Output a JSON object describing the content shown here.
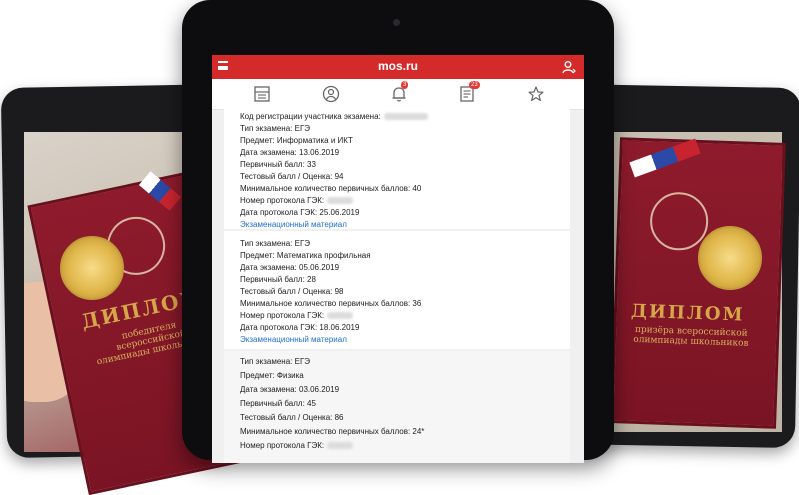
{
  "header": {
    "brand": "mos.ru"
  },
  "nav": {
    "notifications_badge": "3",
    "documents_badge": "23"
  },
  "photos": {
    "left_diploma_title": "ДИПЛОМ",
    "left_diploma_subtitle": "победителя всероссийской олимпиады школьников",
    "right_diploma_title": "ДИПЛОМ",
    "right_diploma_subtitle": "призёра всероссийской олимпиады школьников"
  },
  "exams": {
    "registration_label": "Код регистрации участника экзамена:",
    "card1": {
      "type": "Тип экзамена: ЕГЭ",
      "subject": "Предмет: Информатика и ИКТ",
      "date": "Дата экзамена: 13.06.2019",
      "primary": "Первичный балл: 33",
      "test": "Тестовый балл / Оценка: 94",
      "min": "Минимальное количество первичных баллов: 40",
      "protocol_no": "Номер протокола ГЭК:",
      "protocol_date": "Дата протокола ГЭК: 25.06.2019",
      "material": "Экзаменационный материал"
    },
    "card2": {
      "type": "Тип экзамена: ЕГЭ",
      "subject": "Предмет: Математика профильная",
      "date": "Дата экзамена: 05.06.2019",
      "primary": "Первичный балл: 28",
      "test": "Тестовый балл / Оценка: 98",
      "min": "Минимальное количество первичных баллов: 36",
      "protocol_no": "Номер протокола ГЭК:",
      "protocol_date": "Дата протокола ГЭК: 18.06.2019",
      "material": "Экзаменационный материал"
    },
    "card3": {
      "type": "Тип экзамена: ЕГЭ",
      "subject": "Предмет: Физика",
      "date": "Дата экзамена: 03.06.2019",
      "primary": "Первичный балл: 45",
      "test": "Тестовый балл / Оценка: 86",
      "min": "Минимальное количество первичных баллов: 24*",
      "protocol_no": "Номер протокола ГЭК:"
    }
  },
  "colors": {
    "brand_red": "#d42a2a",
    "link_blue": "#1f6fd1",
    "badge_red": "#e53935"
  }
}
